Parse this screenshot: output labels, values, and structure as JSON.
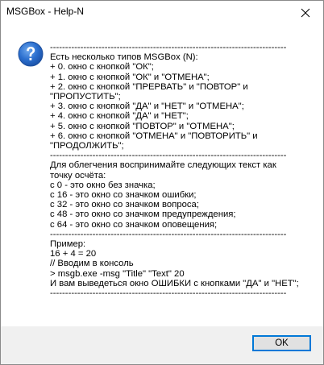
{
  "window": {
    "title": "MSGBox - Help-N"
  },
  "icon": "question-icon",
  "message": {
    "lines": [
      "------------------------------------------------------------------------------",
      "Есть несколько типов MSGBox (N):",
      "+ 0. окно с кнопкой \"ОК\";",
      "+ 1. окно с кнопкой \"ОК\" и \"ОТМЕНА\";",
      "+ 2. окно с кнопкой \"ПРЕРВАТЬ\" и \"ПОВТОР\" и",
      "\"ПРОПУСТИТЬ\";",
      "+ 3. окно с кнопкой \"ДА\" и \"НЕТ\" и \"ОТМЕНА\";",
      "+ 4. окно с кнопкой \"ДА\" и \"НЕТ\";",
      "+ 5. окно с кнопкой \"ПОВТОР\" и \"ОТМЕНА\";",
      "+ 6. окно с кнопкой \"ОТМЕНА\" и \"ПОВТОРИТЬ\" и",
      "\"ПРОДОЛЖИТЬ\";",
      "------------------------------------------------------------------------------",
      "Для облегчения воспринимайте следующих текст как",
      "точку осчёта:",
      "с 0 - это окно без значка;",
      "с 16 - это окно со значком ошибки;",
      "с 32 - это окно со значком вопроса;",
      "с 48 - это окно со значком предупреждения;",
      "с 64 - это окно со значком оповещения;",
      "------------------------------------------------------------------------------",
      "Пример:",
      "16 + 4 = 20",
      "// Вводим в консоль",
      "> msgb.exe -msg \"Title\" \"Text\" 20",
      "И вам выведеться окно ОШИБКИ с кнопками \"ДА\" и \"НЕТ\";",
      "------------------------------------------------------------------------------"
    ]
  },
  "buttons": {
    "ok_label": "OK"
  }
}
